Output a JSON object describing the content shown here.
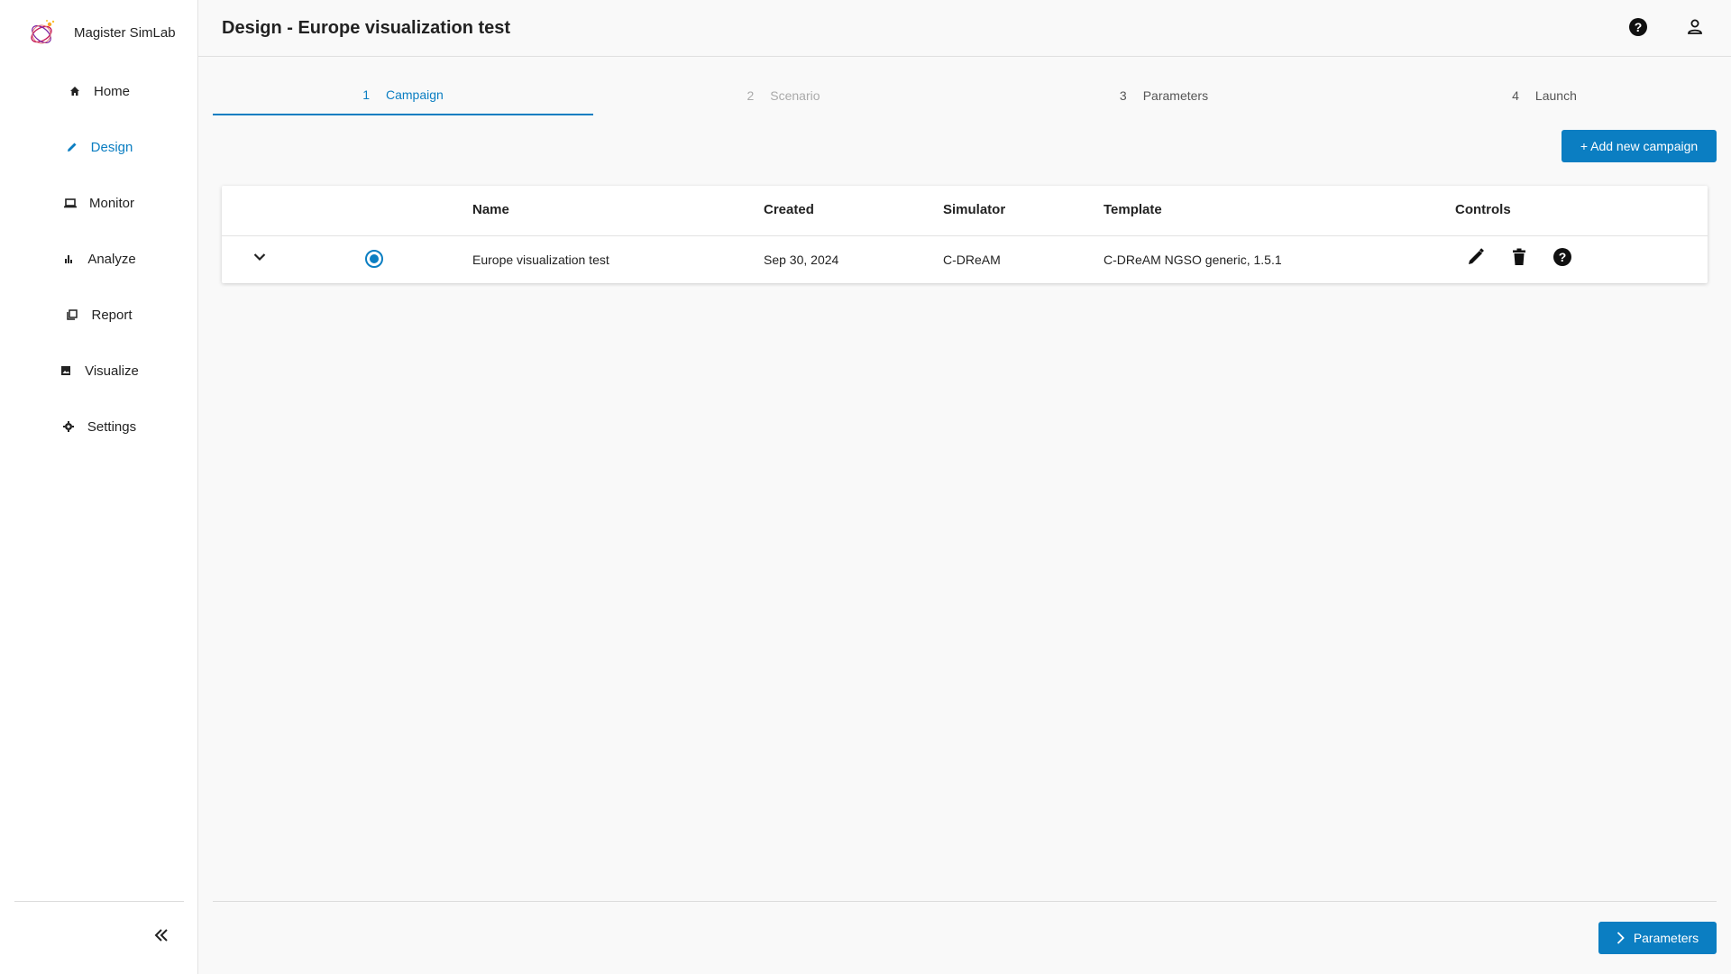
{
  "app": {
    "name": "Magister SimLab"
  },
  "sidebar": {
    "items": [
      {
        "label": "Home",
        "icon": "home-icon"
      },
      {
        "label": "Design",
        "icon": "pencil-icon",
        "active": true
      },
      {
        "label": "Monitor",
        "icon": "laptop-icon"
      },
      {
        "label": "Analyze",
        "icon": "bar-chart-icon"
      },
      {
        "label": "Report",
        "icon": "report-icon"
      },
      {
        "label": "Visualize",
        "icon": "image-icon"
      },
      {
        "label": "Settings",
        "icon": "gear-icon"
      }
    ],
    "collapse_icon": "double-chevron-left-icon"
  },
  "header": {
    "title": "Design - Europe visualization test",
    "help_icon": "help-circle-icon",
    "user_icon": "user-icon"
  },
  "stepper": {
    "steps": [
      {
        "num": "1",
        "label": "Campaign",
        "state": "active"
      },
      {
        "num": "2",
        "label": "Scenario",
        "state": "disabled"
      },
      {
        "num": "3",
        "label": "Parameters",
        "state": "default"
      },
      {
        "num": "4",
        "label": "Launch",
        "state": "default"
      }
    ]
  },
  "actions": {
    "add_campaign": "+ Add new campaign"
  },
  "table": {
    "headers": {
      "name": "Name",
      "created": "Created",
      "simulator": "Simulator",
      "template": "Template",
      "controls": "Controls"
    },
    "rows": [
      {
        "name": "Europe visualization test",
        "created": "Sep 30, 2024",
        "simulator": "C-DReAM",
        "template": "C-DReAM NGSO generic, 1.5.1",
        "selected": true
      }
    ]
  },
  "footer": {
    "next_label": "Parameters"
  },
  "colors": {
    "accent": "#0b7ec2",
    "background": "#f9f9f9"
  }
}
